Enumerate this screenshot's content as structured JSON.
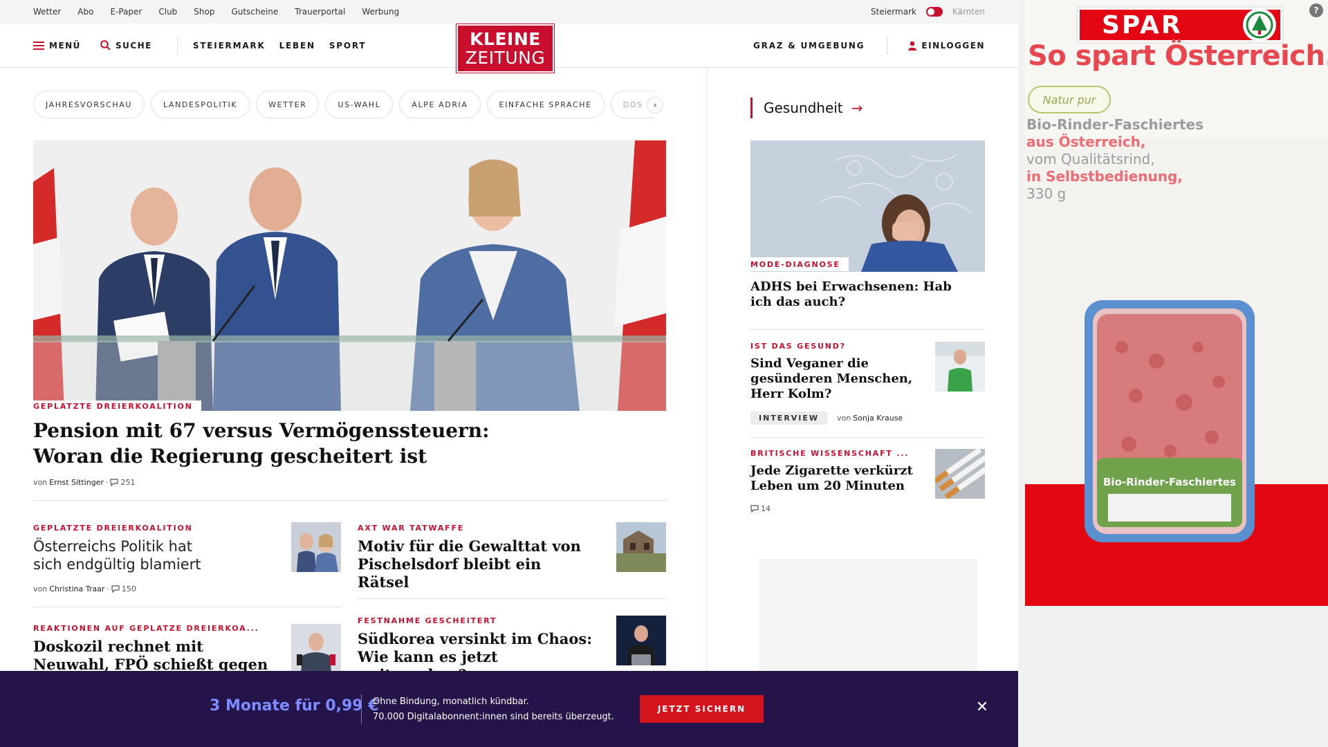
{
  "topbar": {
    "links": [
      "Wetter",
      "Abo",
      "E-Paper",
      "Club",
      "Shop",
      "Gutscheine",
      "Trauerportal",
      "Werbung"
    ],
    "region_left": "Steiermark",
    "region_right": "Kärnten"
  },
  "nav": {
    "menu_label": "MENÜ",
    "search_label": "SUCHE",
    "sections": [
      "STEIERMARK",
      "LEBEN",
      "SPORT"
    ],
    "logo_line1": "KLEINE",
    "logo_line2": "ZEITUNG",
    "region_label": "GRAZ & UMGEBUNG",
    "login_label": "EINLOGGEN"
  },
  "chips": [
    "JAHRESVORSCHAU",
    "LANDESPOLITIK",
    "WETTER",
    "US-WAHL",
    "ALPE ADRIA",
    "EINFACHE SPRACHE",
    "DOS"
  ],
  "hero": {
    "kicker": "GEPLATZTE DREIERKOALITION",
    "title": "Pension mit 67 versus Vermögenssteuern: Woran die Regierung gescheitert ist",
    "by_prefix": "von",
    "author": "Ernst Sittinger",
    "comments": "251"
  },
  "cards": [
    {
      "kicker": "GEPLATZTE DREIERKOALITION",
      "title": "Österreichs Politik hat sich endgültig blamiert",
      "by_prefix": "von",
      "author": "Christina Traar",
      "comments": "150"
    },
    {
      "kicker": "AXT WAR TATWAFFE",
      "title": "Motiv für die Gewalttat von Pischelsdorf bleibt ein Rätsel"
    },
    {
      "kicker": "REAKTIONEN AUF GEPLATZE DREIERKOA...",
      "title": "Doskozil rechnet mit Neuwahl, FPÖ schießt gegen Nehammer"
    },
    {
      "kicker": "FESTNAHME GESCHEITERT",
      "title": "Südkorea versinkt im Chaos: Wie kann es jetzt weitergehen?"
    }
  ],
  "sidebar": {
    "section_title": "Gesundheit",
    "items": [
      {
        "kicker": "MODE-DIAGNOSE",
        "title": "ADHS bei Erwachsenen: Hab ich das auch?"
      },
      {
        "kicker": "IST DAS GESUND?",
        "title": "Sind Veganer die gesünderen Menschen, Herr Kolm?",
        "tag": "INTERVIEW",
        "by_prefix": "von",
        "author": "Sonja Krause"
      },
      {
        "kicker": "BRITISCHE WISSENSCHAFT ...",
        "title": "Jede Zigarette verkürzt Leben um 20 Minuten",
        "comments": "14"
      }
    ]
  },
  "promo": {
    "price": "3 Monate für 0,99 €",
    "line1": "Ohne Bindung, monatlich kündbar.",
    "line2": "70.000 Digitalabonnent:innen sind bereits überzeugt.",
    "cta": "JETZT SICHERN"
  },
  "ad": {
    "brand": "SPAR",
    "slogan": "So spart Österreich.",
    "sub_brand": "Natur pur",
    "copy_line1": "Bio-Rinder-Faschiertes",
    "copy_line2": "aus Österreich,",
    "copy_line3": "vom Qualitätsrind,",
    "copy_line4": "in Selbstbedienung,",
    "copy_line5": "330 g",
    "package_label": "Bio-Rinder-Faschiertes"
  },
  "colors": {
    "brand_red": "#c8102e",
    "promo_bg": "#241449",
    "promo_price": "#7d8cff",
    "spar_red": "#e30613"
  }
}
